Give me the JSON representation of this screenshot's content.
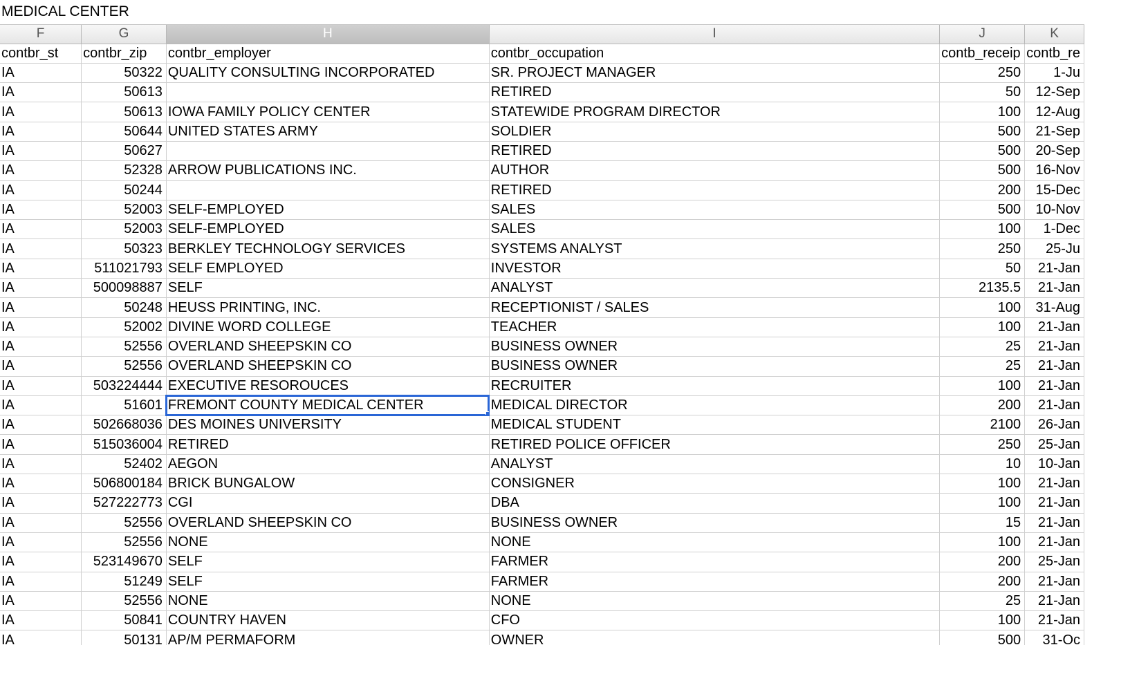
{
  "formula_bar": {
    "value": "MEDICAL CENTER"
  },
  "column_letters": [
    "F",
    "G",
    "H",
    "I",
    "J",
    "K"
  ],
  "selected_column": "H",
  "headers": [
    "contbr_st",
    "contbr_zip",
    "contbr_employer",
    "contbr_occupation",
    "contb_receip",
    "contb_re"
  ],
  "rows": [
    [
      "IA",
      "50322",
      "QUALITY CONSULTING INCORPORATED",
      "SR. PROJECT MANAGER",
      "250",
      "1-Ju"
    ],
    [
      "IA",
      "50613",
      "",
      "RETIRED",
      "50",
      "12-Sep"
    ],
    [
      "IA",
      "50613",
      "IOWA FAMILY POLICY CENTER",
      "STATEWIDE PROGRAM DIRECTOR",
      "100",
      "12-Aug"
    ],
    [
      "IA",
      "50644",
      "UNITED STATES ARMY",
      "SOLDIER",
      "500",
      "21-Sep"
    ],
    [
      "IA",
      "50627",
      "",
      "RETIRED",
      "500",
      "20-Sep"
    ],
    [
      "IA",
      "52328",
      "ARROW PUBLICATIONS INC.",
      "AUTHOR",
      "500",
      "16-Nov"
    ],
    [
      "IA",
      "50244",
      "",
      "RETIRED",
      "200",
      "15-Dec"
    ],
    [
      "IA",
      "52003",
      "SELF-EMPLOYED",
      "SALES",
      "500",
      "10-Nov"
    ],
    [
      "IA",
      "52003",
      "SELF-EMPLOYED",
      "SALES",
      "100",
      "1-Dec"
    ],
    [
      "IA",
      "50323",
      "BERKLEY TECHNOLOGY SERVICES",
      "SYSTEMS ANALYST",
      "250",
      "25-Ju"
    ],
    [
      "IA",
      "511021793",
      "SELF EMPLOYED",
      "INVESTOR",
      "50",
      "21-Jan"
    ],
    [
      "IA",
      "500098887",
      "SELF",
      "ANALYST",
      "2135.5",
      "21-Jan"
    ],
    [
      "IA",
      "50248",
      "HEUSS PRINTING, INC.",
      "RECEPTIONIST / SALES",
      "100",
      "31-Aug"
    ],
    [
      "IA",
      "52002",
      "DIVINE WORD COLLEGE",
      "TEACHER",
      "100",
      "21-Jan"
    ],
    [
      "IA",
      "52556",
      "OVERLAND SHEEPSKIN CO",
      "BUSINESS OWNER",
      "25",
      "21-Jan"
    ],
    [
      "IA",
      "52556",
      "OVERLAND SHEEPSKIN CO",
      "BUSINESS OWNER",
      "25",
      "21-Jan"
    ],
    [
      "IA",
      "503224444",
      "EXECUTIVE RESOROUCES",
      "RECRUITER",
      "100",
      "21-Jan"
    ],
    [
      "IA",
      "51601",
      "FREMONT COUNTY MEDICAL CENTER",
      "MEDICAL DIRECTOR",
      "200",
      "21-Jan"
    ],
    [
      "IA",
      "502668036",
      "DES MOINES UNIVERSITY",
      "MEDICAL STUDENT",
      "2100",
      "26-Jan"
    ],
    [
      "IA",
      "515036004",
      "RETIRED",
      "RETIRED POLICE OFFICER",
      "250",
      "25-Jan"
    ],
    [
      "IA",
      "52402",
      "AEGON",
      "ANALYST",
      "10",
      "10-Jan"
    ],
    [
      "IA",
      "506800184",
      "BRICK BUNGALOW",
      "CONSIGNER",
      "100",
      "21-Jan"
    ],
    [
      "IA",
      "527222773",
      "CGI",
      "DBA",
      "100",
      "21-Jan"
    ],
    [
      "IA",
      "52556",
      "OVERLAND SHEEPSKIN CO",
      "BUSINESS OWNER",
      "15",
      "21-Jan"
    ],
    [
      "IA",
      "52556",
      "NONE",
      "NONE",
      "100",
      "21-Jan"
    ],
    [
      "IA",
      "523149670",
      "SELF",
      "FARMER",
      "200",
      "25-Jan"
    ],
    [
      "IA",
      "51249",
      "SELF",
      "FARMER",
      "200",
      "21-Jan"
    ],
    [
      "IA",
      "52556",
      "NONE",
      "NONE",
      "25",
      "21-Jan"
    ],
    [
      "IA",
      "50841",
      "COUNTRY HAVEN",
      "CFO",
      "100",
      "21-Jan"
    ],
    [
      "IA",
      "50131",
      "AP/M PERMAFORM",
      "OWNER",
      "500",
      "31-Oc"
    ]
  ],
  "active_cell": {
    "row": 17,
    "col": 2
  }
}
